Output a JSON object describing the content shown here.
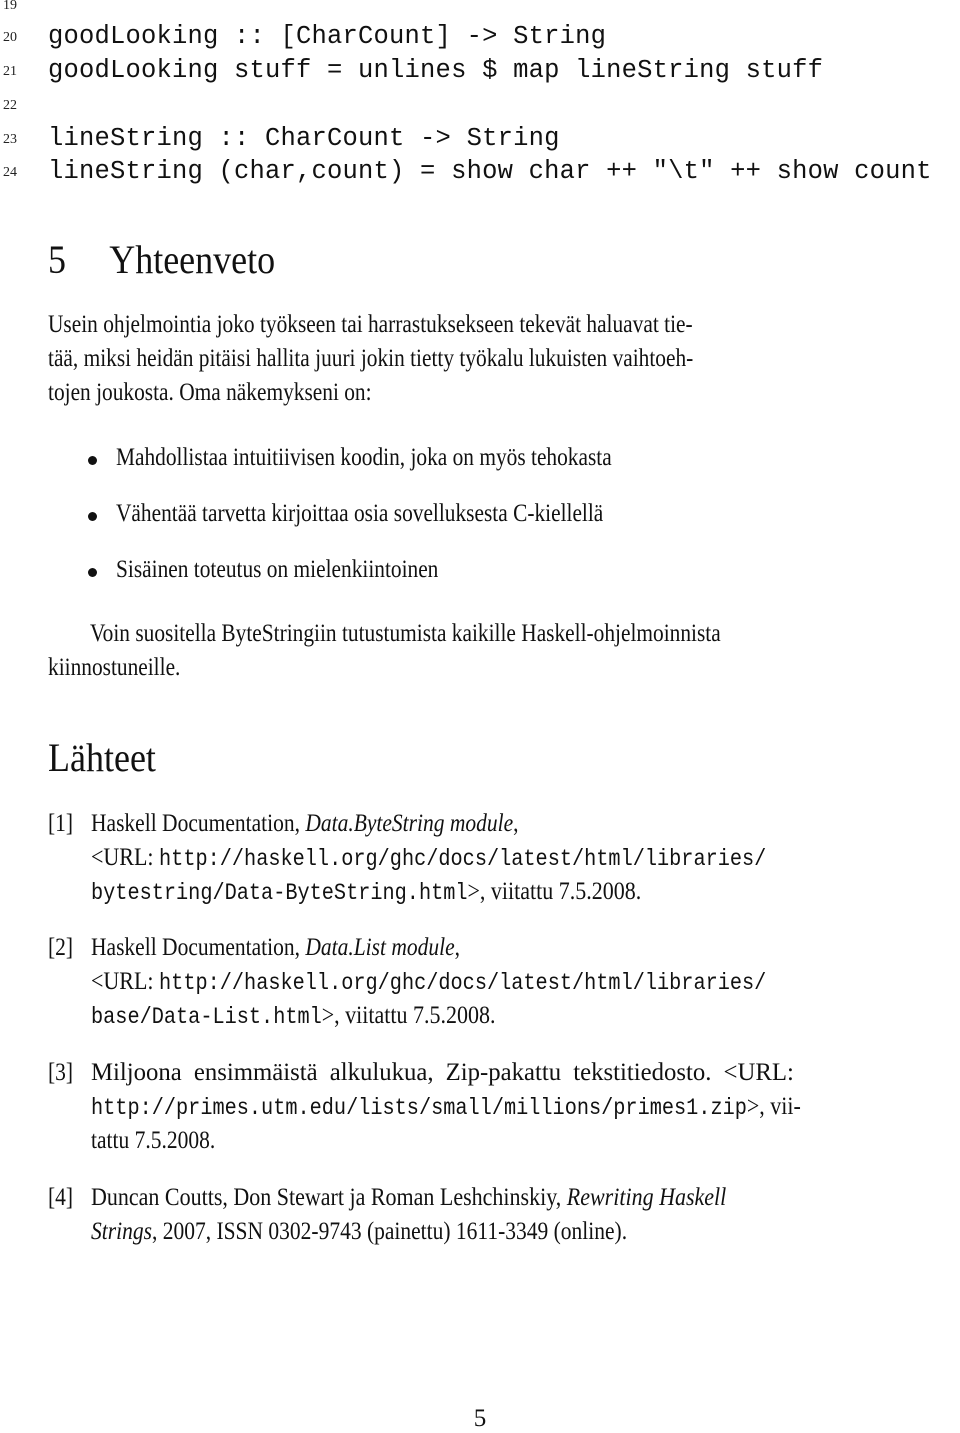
{
  "code_listing": {
    "lines": [
      {
        "number": "19",
        "code": ""
      },
      {
        "number": "20",
        "code": "goodLooking :: [CharCount] -> String"
      },
      {
        "number": "21",
        "code": "goodLooking stuff = unlines $ map lineString stuff"
      },
      {
        "number": "22",
        "code": ""
      },
      {
        "number": "23",
        "code": "lineString :: CharCount -> String"
      },
      {
        "number": "24",
        "code": "lineString (char,count) = show char ++ \"\\t\" ++ show count"
      }
    ]
  },
  "summary_section": {
    "number": "5",
    "title": "Yhteenveto",
    "intro_lines": [
      "Usein ohjelmointia joko työkseen tai harrastuksekseen tekevät haluavat tie-",
      "tää, miksi heidän pitäisi hallita juuri jokin tietty työkalu lukuisten vaihtoeh-",
      "tojen joukosta. Oma näkemykseni on:"
    ],
    "bullets": [
      "Mahdollistaa intuitiivisen koodin, joka on myös tehokasta",
      "Vähentää tarvetta kirjoittaa osia sovelluksesta C-kiellellä",
      "Sisäinen toteutus on mielenkiintoinen"
    ],
    "closing_lines": [
      "Voin suositella ByteStringiin tutustumista kaikille Haskell-ohjelmoinnista",
      "kiinnostuneille."
    ]
  },
  "references_section": {
    "title": "Lähteet",
    "references": [
      {
        "label": "[1]",
        "line1_text": "Haskell Documentation, ",
        "line1_italic": "Data.ByteString module",
        "line1_end": ",",
        "line2_prefix": "<URL: ",
        "line2_url": "http://haskell.org/ghc/docs/latest/html/libraries/",
        "line3_url": "bytestring/Data-ByteString.html",
        "line3_suffix": ">, viitattu 7.5.2008."
      },
      {
        "label": "[2]",
        "line1_text": "Haskell Documentation, ",
        "line1_italic": "Data.List module",
        "line1_end": ",",
        "line2_prefix": "<URL: ",
        "line2_url": "http://haskell.org/ghc/docs/latest/html/libraries/",
        "line3_url": "base/Data-List.html",
        "line3_suffix": ">, viitattu 7.5.2008."
      },
      {
        "label": "[3]",
        "line1_text": "Miljoona ensimmäistä alkulukua, Zip-pakattu tekstitiedosto. <URL:",
        "line2_url": "http://primes.utm.edu/lists/small/millions/primes1.zip",
        "line2_suffix": ">, vii-",
        "line3_text": "tattu 7.5.2008."
      },
      {
        "label": "[4]",
        "line1_text": "Duncan Coutts, Don Stewart ja Roman Leshchinskiy, ",
        "line1_italic": "Rewriting Haskell",
        "line2_italic": "Strings",
        "line2_text": ", 2007, ISSN 0302-9743 (painettu) 1611-3349 (online)."
      }
    ]
  },
  "page_number": "5"
}
